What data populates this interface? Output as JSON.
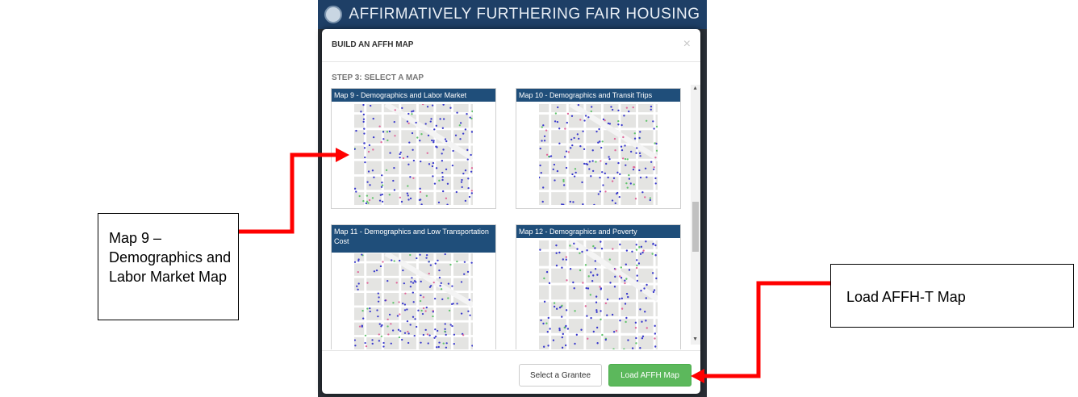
{
  "banner": {
    "title": "AFFIRMATIVELY FURTHERING FAIR HOUSING"
  },
  "modal": {
    "title": "BUILD AN AFFH MAP",
    "close_label": "×",
    "step_label": "STEP 3: SELECT A MAP",
    "cards": [
      {
        "title": "Map 9 - Demographics and Labor Market"
      },
      {
        "title": "Map 10 - Demographics and Transit Trips"
      },
      {
        "title": "Map 11 - Demographics and Low Transportation Cost"
      },
      {
        "title": "Map 12 - Demographics and Poverty"
      }
    ],
    "footer": {
      "select_grantee_label": "Select a Grantee",
      "load_map_label": "Load AFFH Map"
    }
  },
  "callouts": {
    "left": "Map 9 – Demographics and Labor Market Map",
    "right": "Load AFFH-T Map"
  },
  "colors": {
    "header_blue": "#1f4e7a",
    "load_green": "#5cb85c",
    "arrow_red": "#ff0000"
  }
}
